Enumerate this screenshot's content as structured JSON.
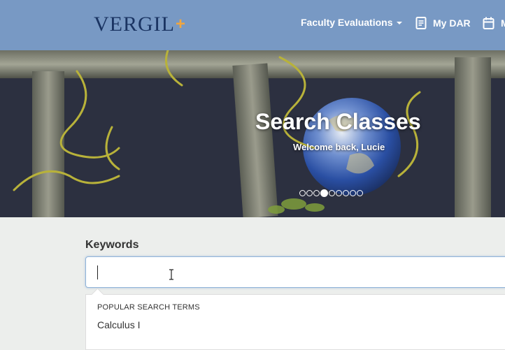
{
  "header": {
    "logo_text": "VERGIL",
    "logo_plus": "+",
    "nav": {
      "faculty_label": "Faculty Evaluations",
      "dar_label": "My DAR",
      "cal_label": "M"
    }
  },
  "hero": {
    "title": "Search Classes",
    "subtitle": "Welcome back, Lucie",
    "carousel": {
      "slide_count": 9,
      "active_index": 3
    }
  },
  "search": {
    "label": "Keywords",
    "value": "",
    "placeholder": ""
  },
  "suggestions": {
    "heading": "POPULAR SEARCH TERMS",
    "items": [
      "Calculus I"
    ]
  },
  "colors": {
    "header_bg": "#7899c4",
    "logo_text": "#1a3462",
    "logo_plus": "#f0a640",
    "page_bg": "#eceeec"
  }
}
